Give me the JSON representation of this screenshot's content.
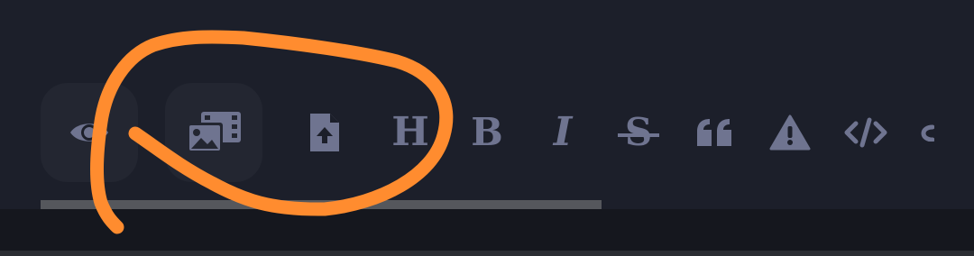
{
  "toolbar": {
    "buttons": [
      {
        "icon": "eye-icon",
        "label": ""
      },
      {
        "icon": "gallery-icon",
        "label": ""
      },
      {
        "icon": "file-upload-icon",
        "label": ""
      },
      {
        "icon": "heading-icon",
        "label": "H"
      },
      {
        "icon": "bold-icon",
        "label": "B"
      },
      {
        "icon": "italic-icon",
        "label": "I"
      },
      {
        "icon": "strikethrough-icon",
        "label": "S"
      },
      {
        "icon": "quote-icon",
        "label": ""
      },
      {
        "icon": "warning-icon",
        "label": ""
      },
      {
        "icon": "code-icon",
        "label": ""
      }
    ]
  },
  "colors": {
    "background": "#1c1f2a",
    "button_fill": "#232631",
    "icon": "#6f7490",
    "annotation": "#ff8c2f",
    "scrollbar": "#55575c",
    "footer": "#15171e"
  }
}
